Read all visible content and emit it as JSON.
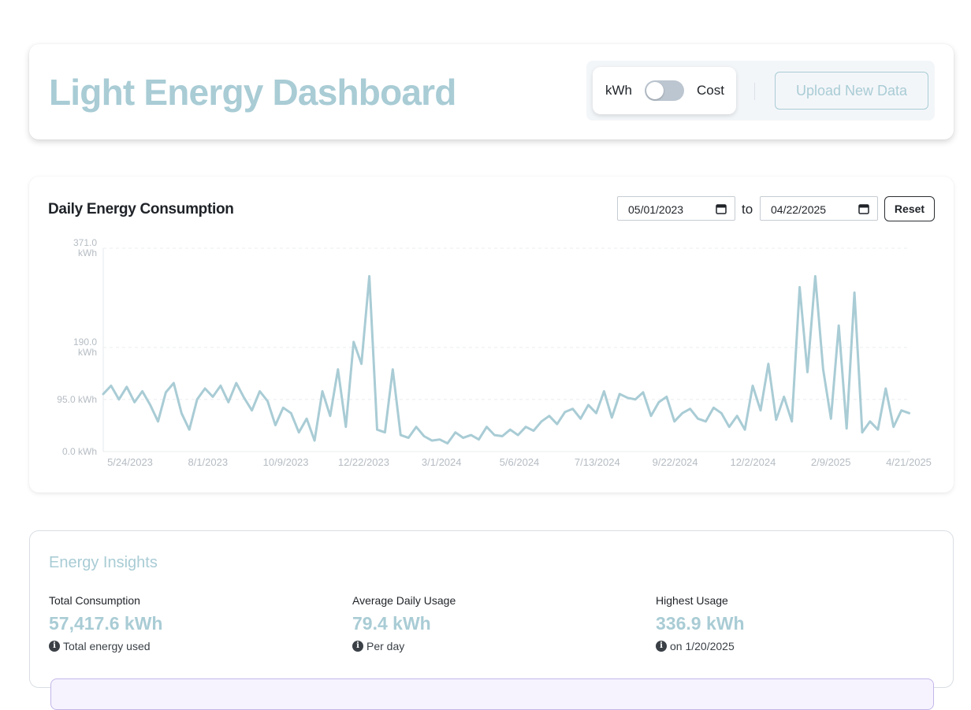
{
  "header": {
    "title": "Light Energy Dashboard",
    "toggle": {
      "left_label": "kWh",
      "right_label": "Cost",
      "selected": "kWh"
    },
    "upload_label": "Upload New Data"
  },
  "chart_panel": {
    "title": "Daily Energy Consumption",
    "start_date": "05/01/2023",
    "end_date": "04/22/2025",
    "to_label": "to",
    "reset_label": "Reset"
  },
  "chart_data": {
    "type": "line",
    "title": "Daily Energy Consumption",
    "xlabel": "",
    "ylabel": "",
    "x_tick_labels": [
      "5/24/2023",
      "8/1/2023",
      "10/9/2023",
      "12/22/2023",
      "3/1/2024",
      "5/6/2024",
      "7/13/2024",
      "9/22/2024",
      "12/2/2024",
      "2/9/2025",
      "4/21/2025"
    ],
    "y_tick_labels": [
      "0.0 kWh",
      "95.0 kWh",
      "190.0 kWh",
      "371.0 kWh"
    ],
    "y_ticks": [
      0,
      95,
      190,
      371
    ],
    "ylim": [
      0,
      371
    ],
    "xlim": [
      "2023-05-01",
      "2025-04-22"
    ],
    "grid": true,
    "color": "#a9ccd5",
    "series": [
      {
        "x": [
          "2023-05-01",
          "2023-05-08",
          "2023-05-15",
          "2023-05-22",
          "2023-05-29",
          "2023-06-05",
          "2023-06-12",
          "2023-06-19",
          "2023-06-26",
          "2023-07-03",
          "2023-07-10",
          "2023-07-17",
          "2023-07-24",
          "2023-07-31",
          "2023-08-07",
          "2023-08-14",
          "2023-08-21",
          "2023-08-28",
          "2023-09-04",
          "2023-09-11",
          "2023-09-18",
          "2023-09-25",
          "2023-10-02",
          "2023-10-09",
          "2023-10-16",
          "2023-10-23",
          "2023-10-30",
          "2023-11-06",
          "2023-11-13",
          "2023-11-20",
          "2023-11-27",
          "2023-12-04",
          "2023-12-11",
          "2023-12-18",
          "2023-12-25",
          "2024-01-01",
          "2024-01-08",
          "2024-01-15",
          "2024-01-22",
          "2024-01-29",
          "2024-02-05",
          "2024-02-12",
          "2024-02-19",
          "2024-02-26",
          "2024-03-04",
          "2024-03-11",
          "2024-03-18",
          "2024-03-25",
          "2024-04-01",
          "2024-04-08",
          "2024-04-15",
          "2024-04-22",
          "2024-04-29",
          "2024-05-06",
          "2024-05-13",
          "2024-05-20",
          "2024-05-27",
          "2024-06-03",
          "2024-06-10",
          "2024-06-17",
          "2024-06-24",
          "2024-07-01",
          "2024-07-08",
          "2024-07-15",
          "2024-07-22",
          "2024-07-29",
          "2024-08-05",
          "2024-08-12",
          "2024-08-19",
          "2024-08-26",
          "2024-09-02",
          "2024-09-09",
          "2024-09-16",
          "2024-09-23",
          "2024-09-30",
          "2024-10-07",
          "2024-10-14",
          "2024-10-21",
          "2024-10-28",
          "2024-11-04",
          "2024-11-11",
          "2024-11-18",
          "2024-11-25",
          "2024-12-02",
          "2024-12-09",
          "2024-12-16",
          "2024-12-23",
          "2024-12-30",
          "2025-01-06",
          "2025-01-13",
          "2025-01-20",
          "2025-01-27",
          "2025-02-03",
          "2025-02-10",
          "2025-02-17",
          "2025-02-24",
          "2025-03-03",
          "2025-03-10",
          "2025-03-17",
          "2025-03-24",
          "2025-03-31",
          "2025-04-07",
          "2025-04-14",
          "2025-04-21"
        ],
        "y": [
          105,
          120,
          95,
          118,
          90,
          110,
          85,
          55,
          108,
          125,
          70,
          40,
          95,
          115,
          100,
          120,
          90,
          125,
          98,
          75,
          110,
          92,
          48,
          80,
          70,
          35,
          60,
          20,
          110,
          65,
          150,
          45,
          200,
          160,
          320,
          40,
          35,
          150,
          30,
          25,
          45,
          28,
          20,
          22,
          15,
          35,
          25,
          30,
          22,
          45,
          30,
          28,
          40,
          30,
          45,
          38,
          55,
          65,
          50,
          72,
          78,
          60,
          85,
          70,
          110,
          62,
          105,
          98,
          95,
          108,
          65,
          90,
          100,
          55,
          70,
          78,
          60,
          55,
          80,
          70,
          45,
          65,
          40,
          120,
          75,
          160,
          58,
          100,
          55,
          300,
          145,
          320,
          150,
          60,
          230,
          42,
          290,
          35,
          55,
          40,
          115,
          45,
          75,
          70
        ]
      }
    ]
  },
  "insights": {
    "title": "Energy Insights",
    "stats": [
      {
        "label": "Total Consumption",
        "value": "57,417.6 kWh",
        "note": "Total energy used"
      },
      {
        "label": "Average Daily Usage",
        "value": "79.4 kWh",
        "note": "Per day"
      },
      {
        "label": "Highest Usage",
        "value": "336.9 kWh",
        "note": "on 1/20/2025"
      }
    ]
  }
}
